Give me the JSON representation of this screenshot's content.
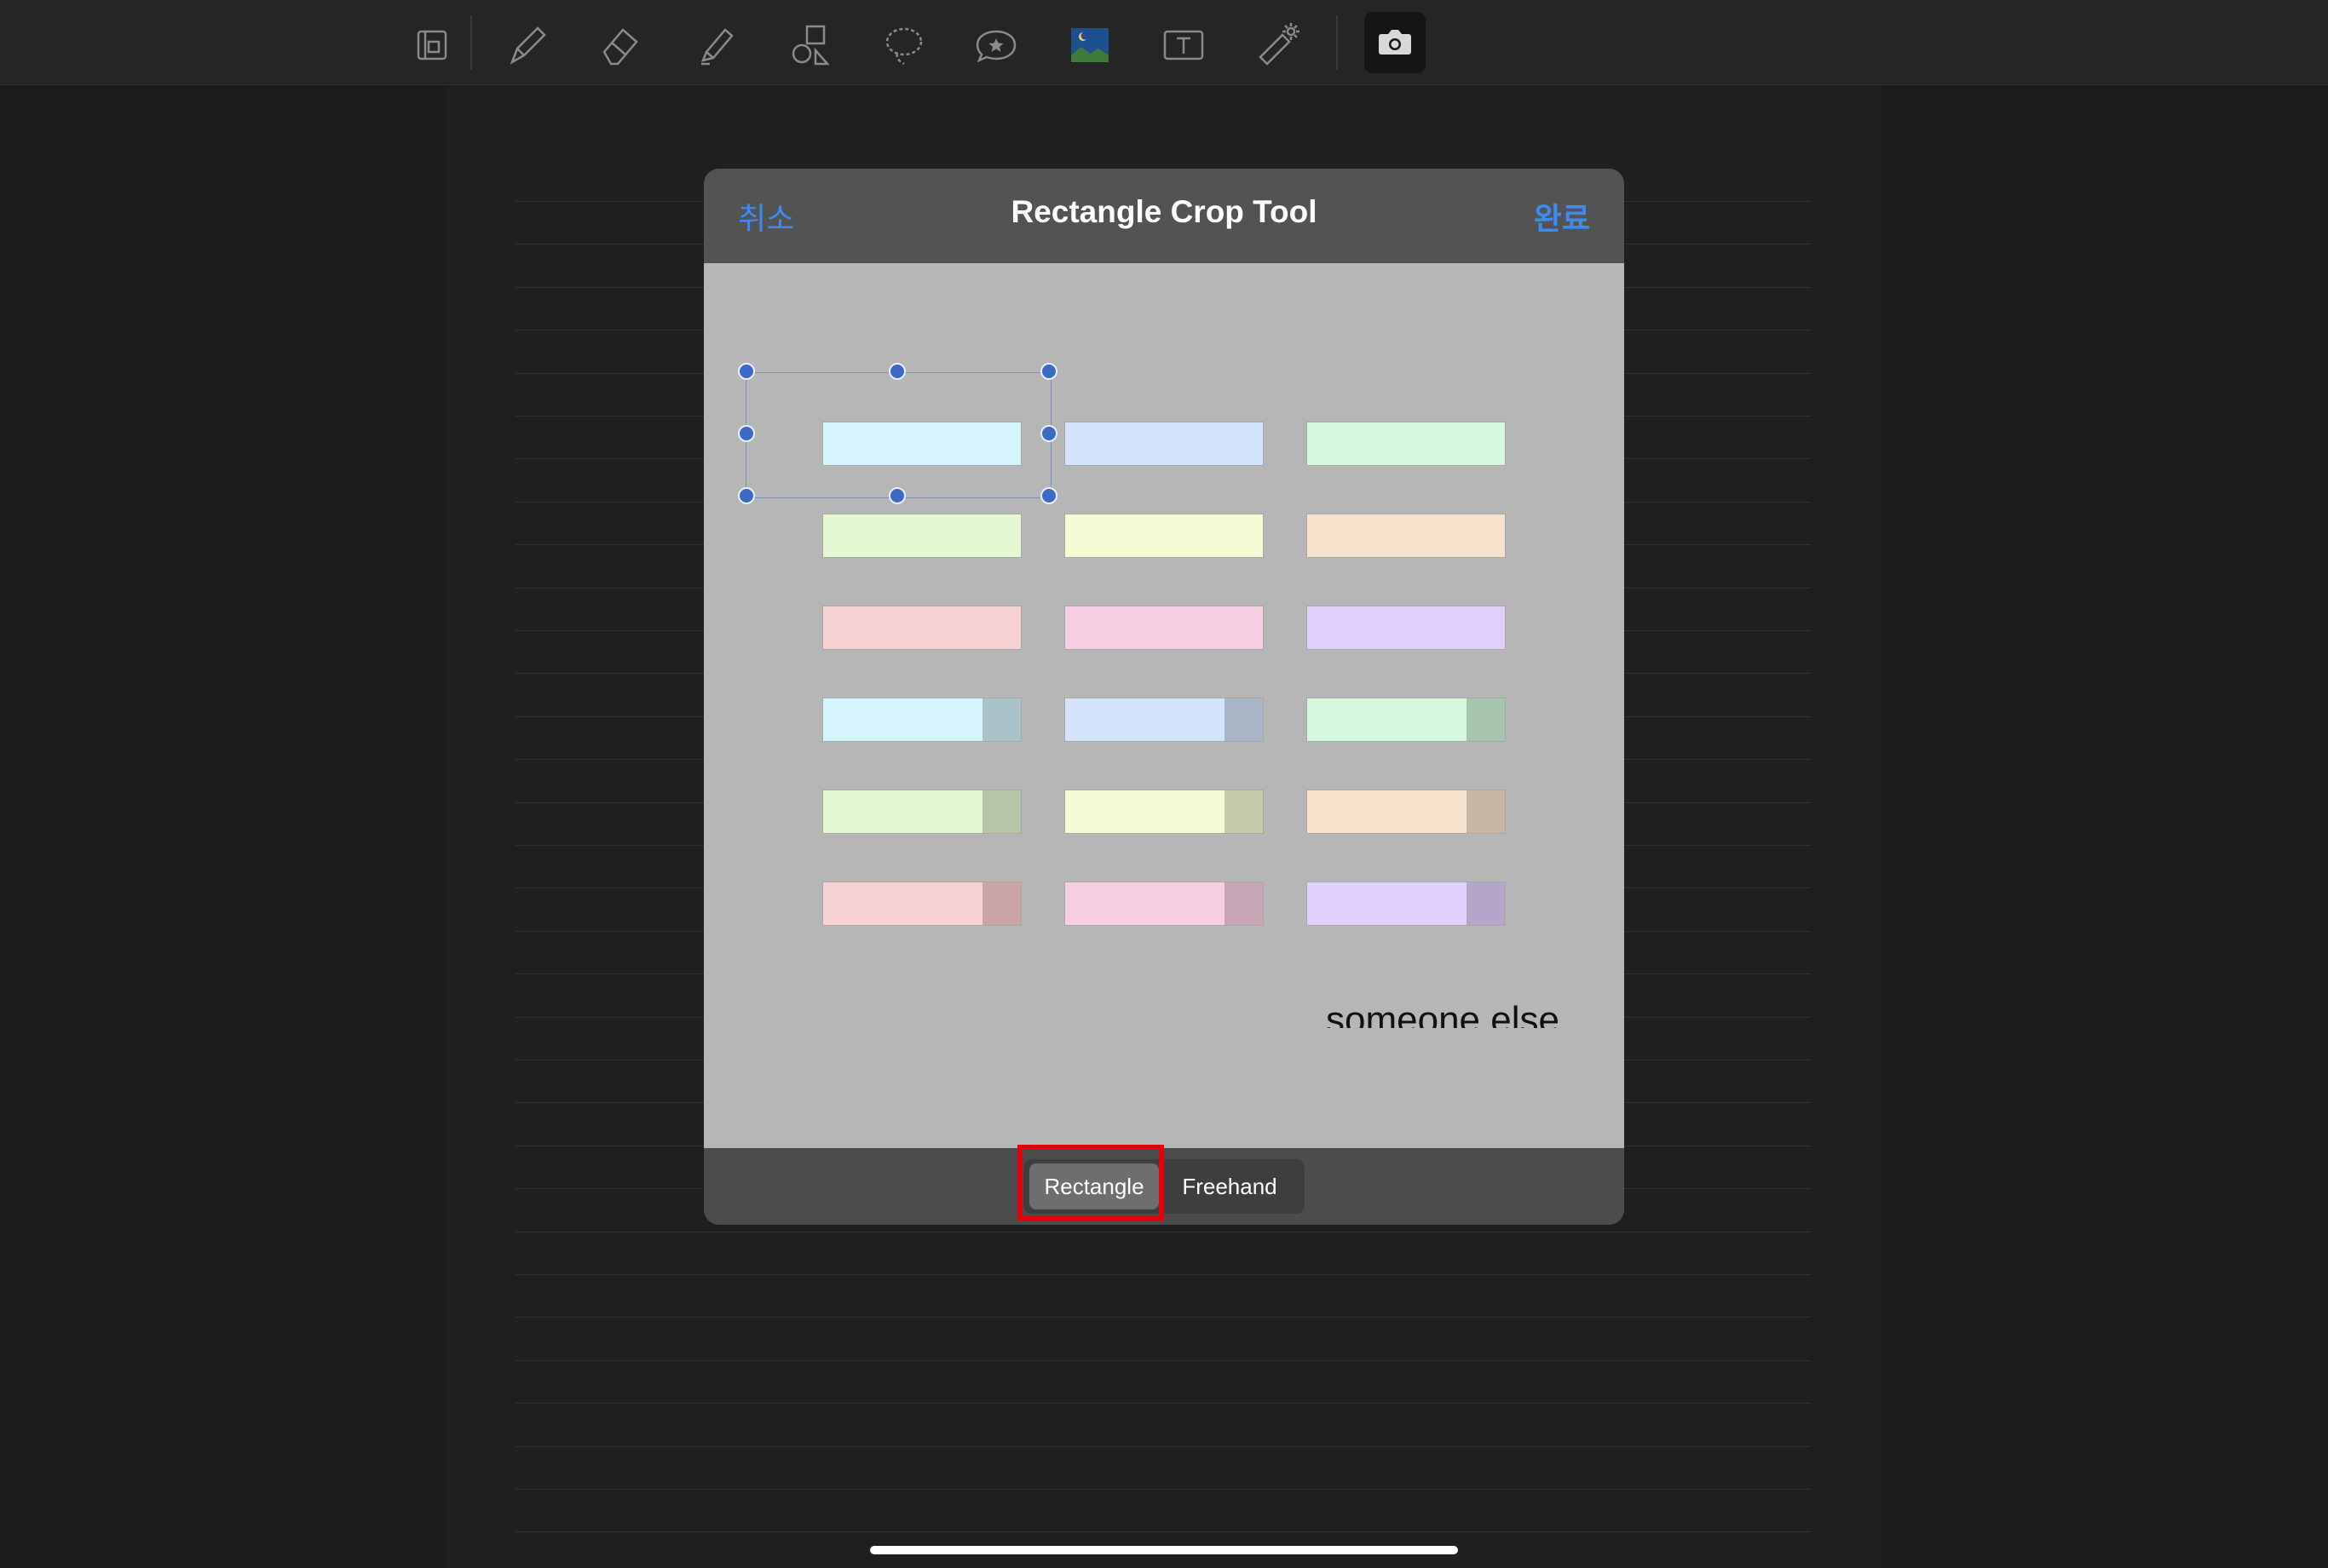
{
  "toolbar": {
    "tools": [
      {
        "icon": "page-layout-icon"
      },
      {
        "icon": "pen-icon"
      },
      {
        "icon": "eraser-icon"
      },
      {
        "icon": "highlighter-icon"
      },
      {
        "icon": "shapes-icon"
      },
      {
        "icon": "lasso-icon"
      },
      {
        "icon": "sticker-icon"
      },
      {
        "icon": "image-icon"
      },
      {
        "icon": "text-box-icon"
      },
      {
        "icon": "laser-pointer-icon"
      },
      {
        "icon": "camera-icon",
        "selected": true
      }
    ]
  },
  "dialog": {
    "title": "Rectangle Crop Tool",
    "cancel_label": "취소",
    "done_label": "완료",
    "preview_text": "someone else",
    "swatches": [
      {
        "color": "#d6f4fb"
      },
      {
        "color": "#d4e4fb"
      },
      {
        "color": "#d6f8dc"
      },
      {
        "color": "#e3f8d3"
      },
      {
        "color": "#f5fbd4"
      },
      {
        "color": "#f7e2cd"
      },
      {
        "color": "#f7d2d2"
      },
      {
        "color": "#f6d0e2"
      },
      {
        "color": "#e0d0fb"
      },
      {
        "color": "#d6f4fb",
        "tab": "#aac3c8"
      },
      {
        "color": "#d4e4fb",
        "tab": "#a8b6c8"
      },
      {
        "color": "#d6f8dc",
        "tab": "#a8c6ad"
      },
      {
        "color": "#e3f8d3",
        "tab": "#b6c5a8"
      },
      {
        "color": "#f5fbd4",
        "tab": "#c6caa8"
      },
      {
        "color": "#f7e2cd",
        "tab": "#c8b6a3"
      },
      {
        "color": "#f7d2d2",
        "tab": "#c9a5a5"
      },
      {
        "color": "#f6d0e2",
        "tab": "#c8a5b5"
      },
      {
        "color": "#e0d0fb",
        "tab": "#b3a6c9"
      }
    ],
    "modes": {
      "rectangle_label": "Rectangle",
      "freehand_label": "Freehand",
      "selected": "Rectangle"
    }
  },
  "colors": {
    "accent": "#3d8bf2",
    "highlight": "#e3000f",
    "handle": "#3d68c4"
  }
}
